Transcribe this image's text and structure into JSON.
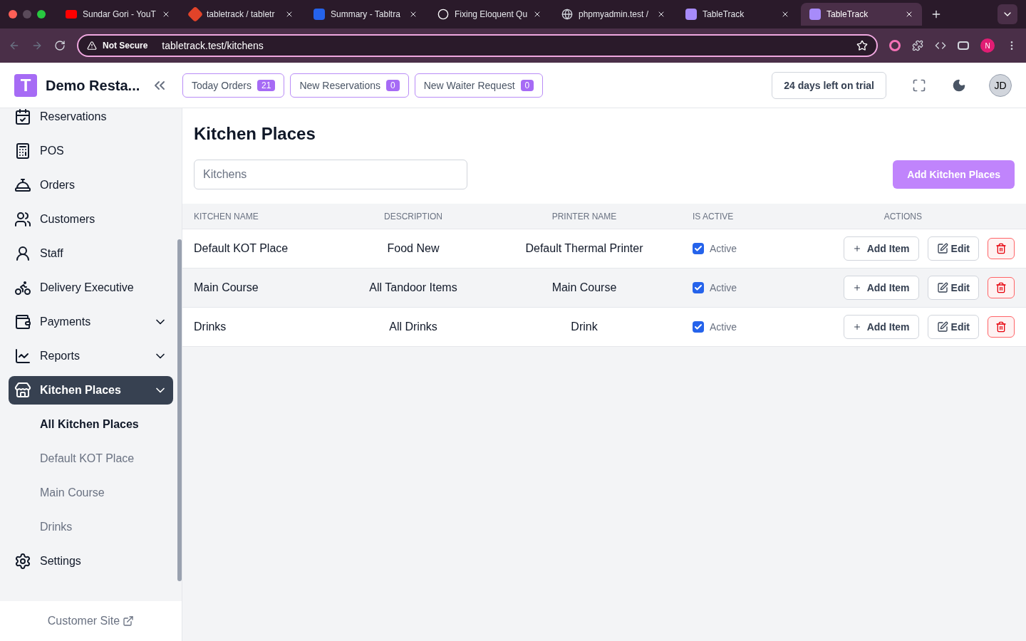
{
  "browser": {
    "tabs": [
      {
        "title": "Sundar Gori - YouT",
        "selected": false
      },
      {
        "title": "tabletrack / tabletr",
        "selected": false
      },
      {
        "title": "Summary - Tabltra",
        "selected": false
      },
      {
        "title": "Fixing Eloquent Qu",
        "selected": false
      },
      {
        "title": "phpmyadmin.test /",
        "selected": false
      },
      {
        "title": "TableTrack",
        "selected": false
      },
      {
        "title": "TableTrack",
        "selected": true
      }
    ],
    "security": "Not Secure",
    "url": "tabletrack.test/kitchens",
    "profile": "N"
  },
  "header": {
    "logo": "T",
    "restaurant": "Demo Resta...",
    "counters": [
      {
        "label": "Today Orders",
        "count": "21"
      },
      {
        "label": "New Reservations",
        "count": "0"
      },
      {
        "label": "New Waiter Request",
        "count": "0"
      }
    ],
    "trial": "24 days left on trial",
    "avatar": "JD"
  },
  "sidebar": {
    "items": [
      {
        "label": "Reservations",
        "kind": "link",
        "selected": false
      },
      {
        "label": "POS",
        "kind": "link",
        "selected": false
      },
      {
        "label": "Orders",
        "kind": "link",
        "selected": false
      },
      {
        "label": "Customers",
        "kind": "link",
        "selected": false
      },
      {
        "label": "Staff",
        "kind": "link",
        "selected": false
      },
      {
        "label": "Delivery Executive",
        "kind": "link",
        "selected": false
      },
      {
        "label": "Payments",
        "kind": "group",
        "selected": false
      },
      {
        "label": "Reports",
        "kind": "group",
        "selected": false
      },
      {
        "label": "Kitchen Places",
        "kind": "group",
        "selected": true,
        "children": [
          {
            "label": "All Kitchen Places",
            "selected": true
          },
          {
            "label": "Default KOT Place",
            "selected": false
          },
          {
            "label": "Main Course",
            "selected": false
          },
          {
            "label": "Drinks",
            "selected": false
          }
        ]
      },
      {
        "label": "Settings",
        "kind": "link",
        "selected": false
      }
    ],
    "footer_link": "Customer Site"
  },
  "page": {
    "title": "Kitchen Places",
    "search": {
      "placeholder": "Kitchens"
    },
    "add_button": "Add Kitchen Places",
    "table": {
      "columns": [
        "KITCHEN NAME",
        "DESCRIPTION",
        "PRINTER NAME",
        "IS ACTIVE",
        "ACTIONS"
      ],
      "rows": [
        {
          "name": "Default KOT Place",
          "description": "Food New",
          "printer": "Default Thermal Printer",
          "active": true,
          "active_label": "Active",
          "highlighted": false,
          "add_item": "Add Item",
          "edit": "Edit"
        },
        {
          "name": "Main Course",
          "description": "All Tandoor Items",
          "printer": "Main Course",
          "active": true,
          "active_label": "Active",
          "highlighted": true,
          "add_item": "Add Item",
          "edit": "Edit"
        },
        {
          "name": "Drinks",
          "description": "All Drinks",
          "printer": "Drink",
          "active": true,
          "active_label": "Active",
          "highlighted": false,
          "add_item": "Add Item",
          "edit": "Edit"
        }
      ]
    }
  }
}
